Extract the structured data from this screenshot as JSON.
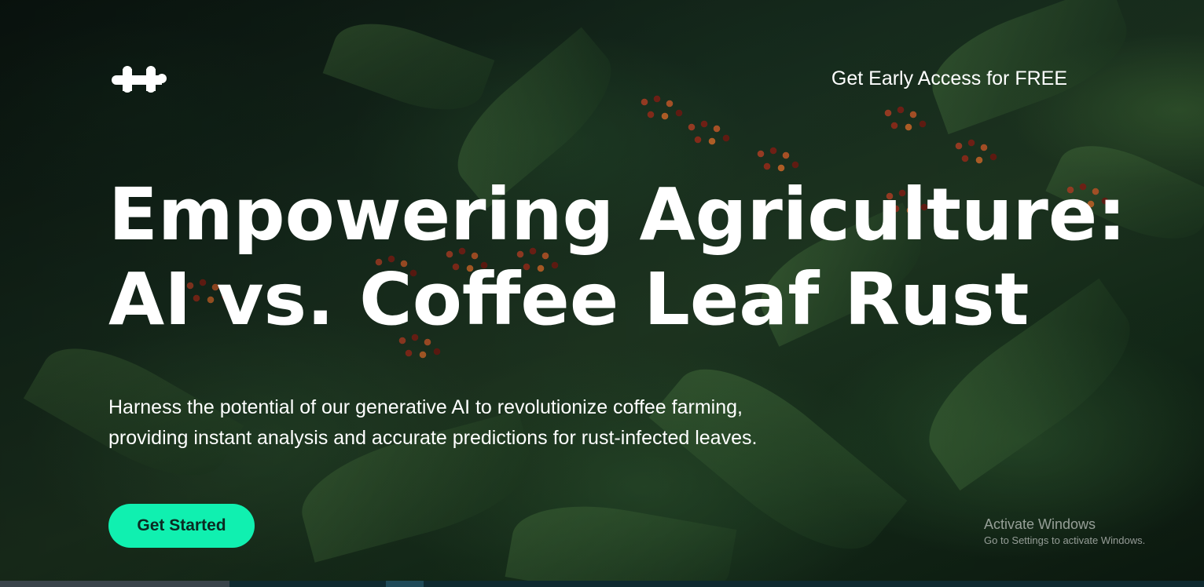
{
  "brand": {
    "logo_icon": "molecule-logo-icon"
  },
  "nav": {
    "early_access_label": "Get Early Access for FREE"
  },
  "hero": {
    "headline_line1": "Empowering Agriculture:",
    "headline_line2": "AI vs. Coffee Leaf Rust",
    "subtitle_line1": "Harness the potential of our generative AI to revolutionize coffee farming,",
    "subtitle_line2": "providing instant analysis and accurate predictions for rust-infected leaves.",
    "cta_label": "Get Started",
    "background": "coffee-plant-photo"
  },
  "watermark": {
    "title": "Activate Windows",
    "subtitle": "Go to Settings to activate Windows."
  },
  "colors": {
    "accent": "#10f0b0",
    "text": "#ffffff",
    "cta_text": "#0b2a22"
  }
}
